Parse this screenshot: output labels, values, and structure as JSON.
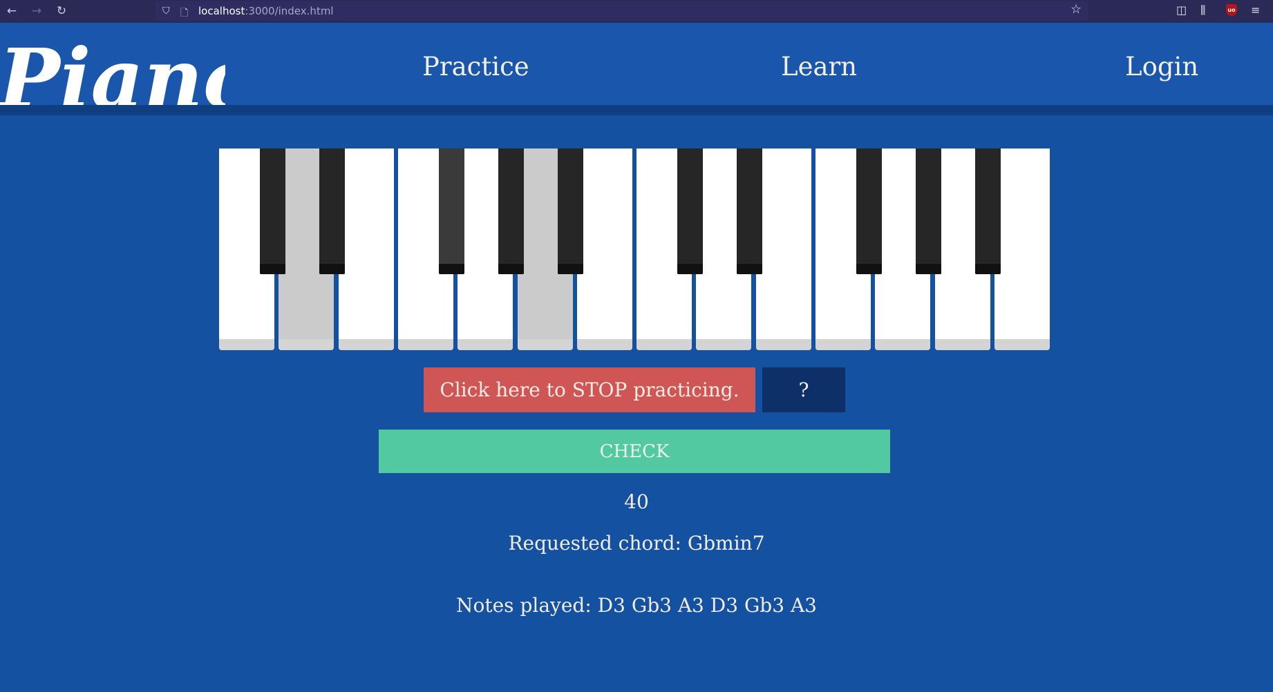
{
  "browser": {
    "url_host": "localhost",
    "url_rest": ":3000/index.html",
    "icons": [
      "back-arrow-icon",
      "forward-arrow-icon",
      "reload-icon",
      "shield-icon",
      "page-icon",
      "star-icon",
      "pocket-icon",
      "library-icon",
      "ublock-icon",
      "menu-icon"
    ]
  },
  "header": {
    "logo_text": "Piano",
    "nav": [
      "Practice",
      "Learn",
      "Login"
    ]
  },
  "piano": {
    "white_keys": [
      "C",
      "D",
      "E",
      "F",
      "G",
      "A",
      "B",
      "C",
      "D",
      "E",
      "F",
      "G",
      "A",
      "B"
    ],
    "black_keys": [
      "C#",
      "D#",
      "F#",
      "G#",
      "A#",
      "C#",
      "D#",
      "F#",
      "G#",
      "A#"
    ],
    "pressed_white": [
      1,
      5
    ],
    "pressed_black": [
      2
    ]
  },
  "controls": {
    "stop_label": "Click here to STOP practicing.",
    "help_label": "?",
    "check_label": "CHECK"
  },
  "status": {
    "score": "40",
    "requested_chord": "Requested chord: Gbmin7",
    "notes_played": "Notes played: D3 Gb3 A3 D3 Gb3 A3"
  },
  "colors": {
    "background": "#1451a0",
    "header": "#1a56ab",
    "stop": "#d05555",
    "help": "#0d3068",
    "check": "#52c9a0"
  }
}
